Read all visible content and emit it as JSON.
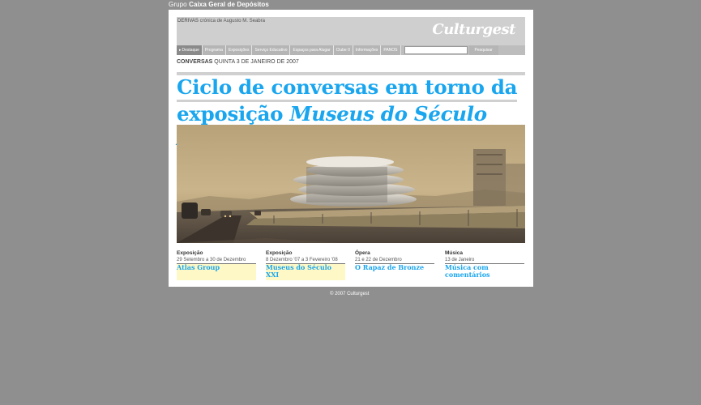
{
  "topbar": {
    "prefix": "Grupo",
    "brand": "Caixa Geral de Depósitos"
  },
  "header": {
    "derivas_label": "DERIVAS",
    "derivas_text": "crónica de Augusto M. Seabra",
    "logo": "Culturgest"
  },
  "nav": {
    "items": [
      {
        "label": "Destaque",
        "active": true
      },
      {
        "label": "Programa"
      },
      {
        "label": "Exposições"
      },
      {
        "label": "Serviço Educativo"
      },
      {
        "label": "Espaços para Alugar"
      },
      {
        "label": "Clube 0"
      },
      {
        "label": "Informações"
      },
      {
        "label": "PANOS"
      }
    ],
    "search_placeholder": "",
    "search_button": "Pesquisar"
  },
  "section": {
    "label": "CONVERSAS",
    "date": "QUINTA 3 DE JANEIRO DE 2007"
  },
  "headline": {
    "line1": "Ciclo de conversas em torno da",
    "line2_prefix": "exposição",
    "line2_italic": "Museus do Século XXI"
  },
  "cards": [
    {
      "type": "Exposição",
      "date": "29 Setembro a 30 de Dezembro",
      "title": "Atlas Group"
    },
    {
      "type": "Exposição",
      "date": "8 Dezembro '07 a 3 Fevereiro '08",
      "title": "Museus do Século XXI"
    },
    {
      "type": "Ópera",
      "date": "21 e 22 de Dezembro",
      "title": "O Rapaz de Bronze"
    },
    {
      "type": "Música",
      "date": "13 de Janeiro",
      "title": "Música com comentários"
    }
  ],
  "footer": {
    "copyright": "© 2007 Culturgest"
  },
  "colors": {
    "accent": "#1aa6ef",
    "highlight": "#fdf8c6",
    "background": "#8f8f8f"
  }
}
